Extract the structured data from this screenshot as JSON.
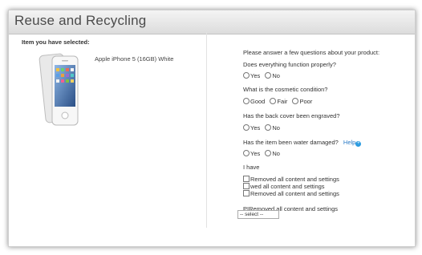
{
  "header": {
    "title": "Reuse and Recycling"
  },
  "left": {
    "selected_label": "Item you have selected:",
    "product_name": "Apple iPhone 5 (16GB) White"
  },
  "questions": {
    "intro": "Please answer a few questions about your product:",
    "q1": {
      "text": "Does everything function properly?",
      "options": [
        "Yes",
        "No"
      ]
    },
    "q2": {
      "text": "What is the cosmetic condition?",
      "options": [
        "Good",
        "Fair",
        "Poor"
      ]
    },
    "q3": {
      "text": "Has the back cover been engraved?",
      "options": [
        "Yes",
        "No"
      ]
    },
    "q4": {
      "text": "Has the item been water damaged?",
      "help": "Help",
      "options": [
        "Yes",
        "No"
      ]
    },
    "i_have": {
      "label": "I have",
      "items": [
        "Removed all content and settings",
        "wed all content and settings",
        "Removed all content and settings"
      ]
    },
    "p_label": "PIRemoved all content and settings",
    "select_value": "-- select --"
  }
}
